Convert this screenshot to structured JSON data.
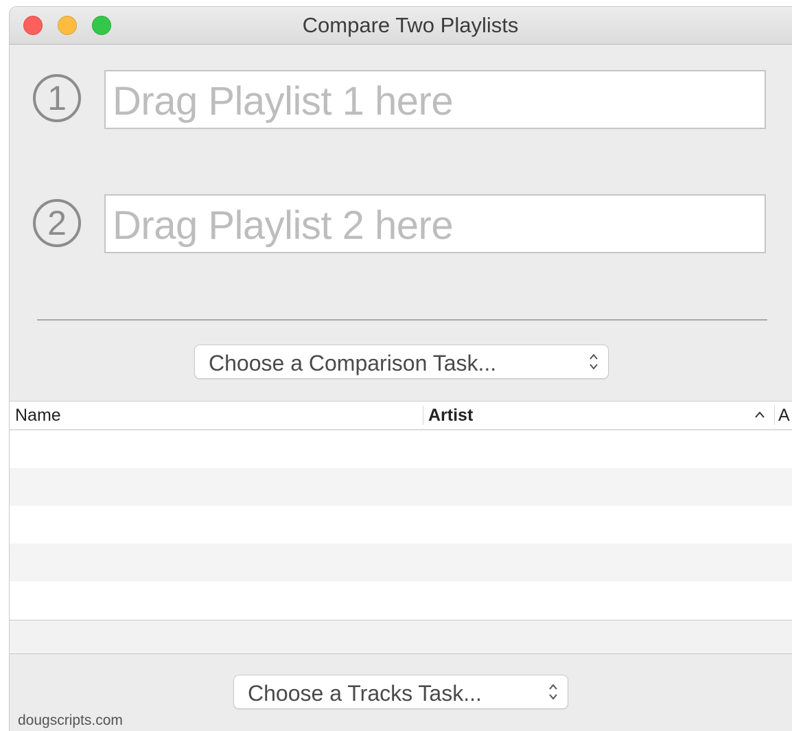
{
  "window": {
    "title": "Compare Two Playlists",
    "traffic_lights": {
      "close": "#fc605c",
      "minimize": "#fdbc40",
      "maximize": "#34c84a"
    }
  },
  "playlist1": {
    "number": "1",
    "placeholder": "Drag Playlist 1 here"
  },
  "playlist2": {
    "number": "2",
    "placeholder": "Drag Playlist 2 here"
  },
  "comparison_task": {
    "label": "Choose a Comparison Task..."
  },
  "table": {
    "columns": [
      "Name",
      "Artist",
      "A"
    ],
    "sorted_column": "Artist",
    "sort_direction": "ascending",
    "rows": []
  },
  "tracks_task": {
    "label": "Choose a Tracks Task..."
  },
  "footer": {
    "credit": "dougscripts.com"
  }
}
